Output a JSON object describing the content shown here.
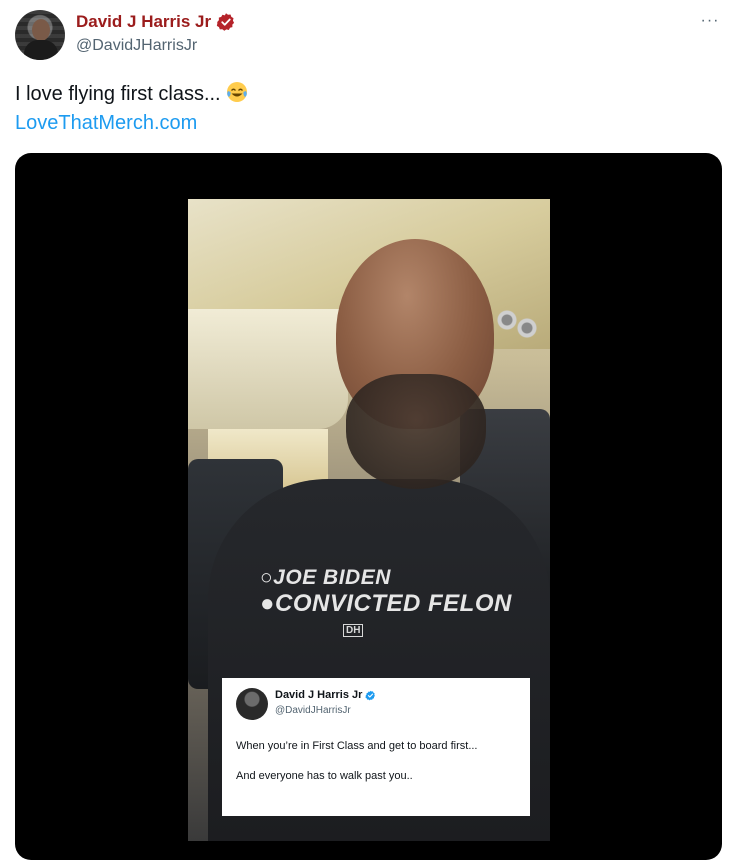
{
  "author": {
    "display_name": "David J Harris Jr",
    "handle": "@DavidJHarrisJr",
    "verified": true,
    "name_color": "#9b1c1c",
    "avatar_icon": "profile-photo"
  },
  "menu": {
    "more_label": "···"
  },
  "tweet": {
    "text": "I love flying first class...",
    "emoji": "face-with-tears-of-joy",
    "link": "LoveThatMerch.com",
    "link_color": "#1d9bf0"
  },
  "media": {
    "type": "video",
    "shirt": {
      "line1": "○JOE BIDEN",
      "line2": "●CONVICTED FELON",
      "logo": "DH"
    },
    "embedded_post": {
      "display_name": "David J Harris Jr",
      "handle": "@DavidJHarrisJr",
      "verified_badge_color": "#1d9bf0",
      "line1": "When you’re in First Class and get to board first...",
      "line2": "And everyone has to walk past you.."
    }
  }
}
